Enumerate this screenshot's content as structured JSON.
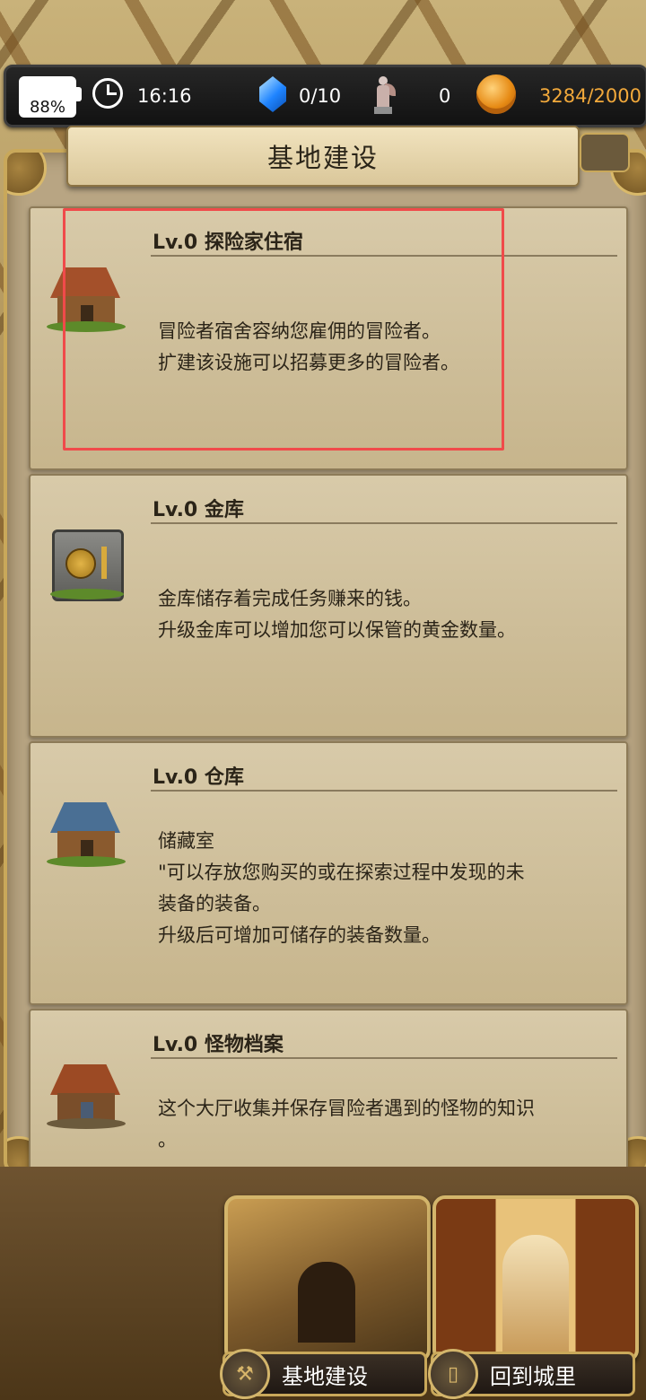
{
  "status": {
    "battery": "88%",
    "time": "16:16",
    "gems": "0/10",
    "statues": "0",
    "gold": "3284/2000"
  },
  "header": {
    "title": "基地建设"
  },
  "buildings": [
    {
      "title": "Lv.0 探险家住宿",
      "desc": [
        "冒险者宿舍容纳您雇佣的冒险者。",
        "扩建该设施可以招募更多的冒险者。"
      ],
      "icon": "house-icon"
    },
    {
      "title": "Lv.0 金库",
      "desc": [
        "金库储存着完成任务赚来的钱。",
        "升级金库可以增加您可以保管的黄金数量。"
      ],
      "icon": "vault-icon"
    },
    {
      "title": "Lv.0 仓库",
      "desc": [
        "储藏室",
        "\"可以存放您购买的或在探索过程中发现的未",
        "装备的装备。",
        "升级后可增加可储存的装备数量。"
      ],
      "icon": "warehouse-icon"
    },
    {
      "title": "Lv.0 怪物档案",
      "desc": [
        "这个大厅收集并保存冒险者遇到的怪物的知识",
        "。"
      ],
      "icon": "archive-icon"
    }
  ],
  "nav": {
    "build_label": "基地建设",
    "town_label": "回到城里"
  },
  "colors": {
    "gold_text": "#f2a93b",
    "highlight": "#f04a4a"
  }
}
